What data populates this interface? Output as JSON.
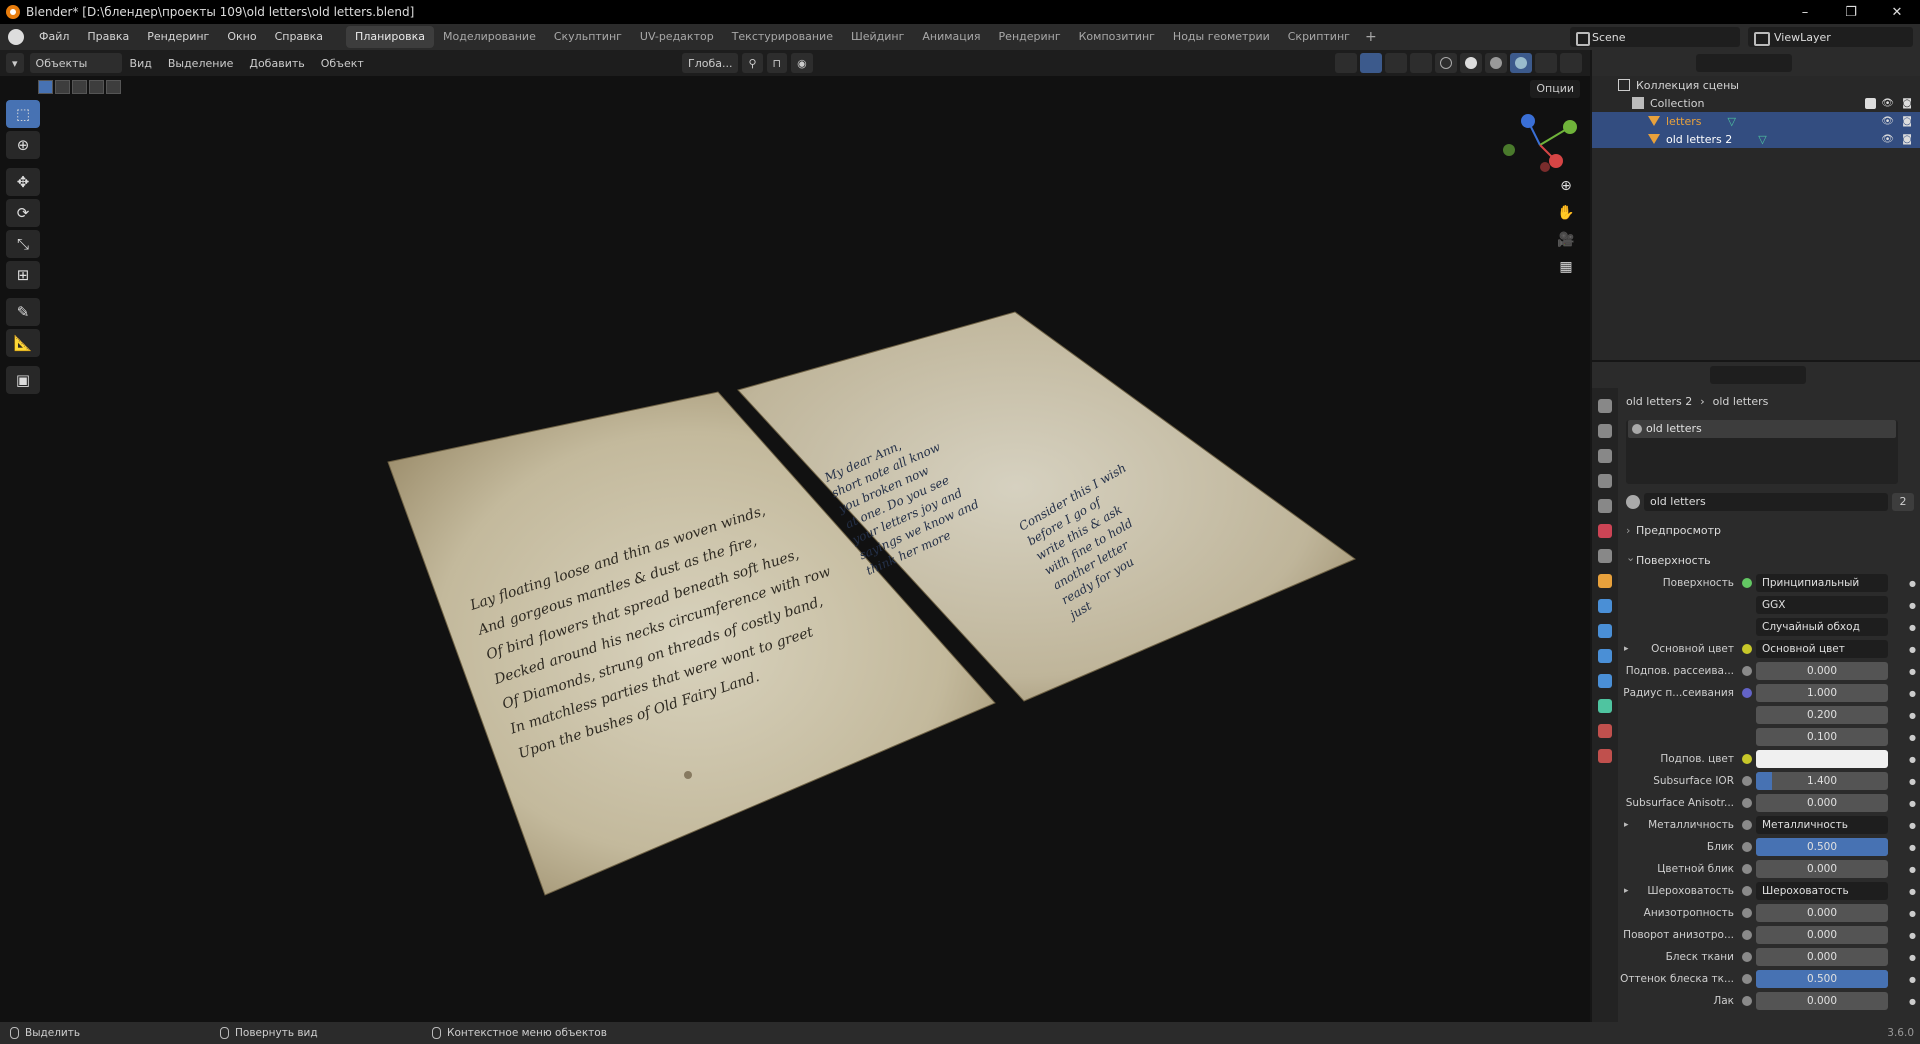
{
  "window": {
    "title": "Blender* [D:\\блендер\\проекты 109\\old letters\\old letters.blend]",
    "controls": {
      "minimize": "–",
      "maximize": "❐",
      "close": "✕"
    }
  },
  "menubar": {
    "menus": [
      "Файл",
      "Правка",
      "Рендеринг",
      "Окно",
      "Справка"
    ],
    "workspaces": [
      "Планировка",
      "Моделирование",
      "Скульптинг",
      "UV-редактор",
      "Текстурирование",
      "Шейдинг",
      "Анимация",
      "Рендеринг",
      "Композитинг",
      "Ноды геометрии",
      "Скриптинг"
    ],
    "active_workspace": "Планировка",
    "add_workspace": "+",
    "scene": "Scene",
    "view_layer": "ViewLayer"
  },
  "viewport_header": {
    "mode": "Объекты",
    "menus": [
      "Вид",
      "Выделение",
      "Добавить",
      "Объект"
    ],
    "orientation": "Глоба...",
    "options": "Опции"
  },
  "toolbar": {
    "icons": [
      "select-box-icon",
      "cursor-icon",
      "move-icon",
      "rotate-icon",
      "scale-icon",
      "transform-icon",
      "annotate-icon",
      "measure-icon",
      "add-cube-icon"
    ]
  },
  "scene_view": {
    "letter1_lines": [
      "Lay floating loose and thin as woven winds,",
      "And gorgeous mantles & dust as the fire,",
      "Of bird flowers that spread beneath soft hues,",
      "Decked around his necks circumference with row",
      "Of Diamonds, strung on threads of costly band,",
      "In matchless parties that were wont to greet",
      "Upon the bushes of Old Fairy Land."
    ],
    "letter2_lines_left": [
      "My dear Ann,",
      "short note all know",
      "you broken now",
      "at one. Do you see",
      "your letters joy and",
      "sayings we know and",
      "think her more"
    ],
    "letter2_lines_right": [
      "Consider this I wish",
      "before I go of",
      "write this & ask",
      "with fine to hold",
      "another letter",
      "ready for you",
      "just"
    ]
  },
  "outliner": {
    "root": "Коллекция сцены",
    "collection": "Collection",
    "items": [
      {
        "name": "letters",
        "selected": true,
        "color": "#e8a13c"
      },
      {
        "name": "old letters 2",
        "selected": true,
        "color": "#ffffff"
      }
    ]
  },
  "properties": {
    "breadcrumb": {
      "object": "old letters 2",
      "material": "old letters"
    },
    "slots": [
      "old letters"
    ],
    "material_name": "old letters",
    "material_users": "2",
    "panels": {
      "preview": "Предпросмотр",
      "surface": "Поверхность"
    },
    "rows": [
      {
        "label": "Поверхность",
        "type": "node",
        "value": "Принципиальный BSDF",
        "dot": "green"
      },
      {
        "label": "",
        "type": "dropdown",
        "value": "GGX"
      },
      {
        "label": "",
        "type": "dropdown",
        "value": "Случайный обход"
      },
      {
        "label": "Основной цвет",
        "type": "node",
        "value": "Основной цвет",
        "dot": "yellow",
        "expand": true
      },
      {
        "label": "Подпов. рассеива...",
        "type": "num",
        "value": "0.000",
        "dot": "grey",
        "fill": 0
      },
      {
        "label": "Радиус п...сеивания",
        "type": "num",
        "value": "1.000",
        "dot": "blue",
        "fill": 0
      },
      {
        "label": "",
        "type": "num",
        "value": "0.200",
        "fill": 0
      },
      {
        "label": "",
        "type": "num",
        "value": "0.100",
        "fill": 0
      },
      {
        "label": "Подпов. цвет",
        "type": "color",
        "value": "",
        "dot": "yellow"
      },
      {
        "label": "Subsurface IOR",
        "type": "num",
        "value": "1.400",
        "dot": "grey",
        "fill": 0.12
      },
      {
        "label": "Subsurface Anisotr...",
        "type": "num",
        "value": "0.000",
        "dot": "grey",
        "fill": 0
      },
      {
        "label": "Металличность",
        "type": "node",
        "value": "Металличность",
        "dot": "grey",
        "expand": true
      },
      {
        "label": "Блик",
        "type": "num",
        "value": "0.500",
        "dot": "grey",
        "fill": 1.0
      },
      {
        "label": "Цветной блик",
        "type": "num",
        "value": "0.000",
        "dot": "grey",
        "fill": 0
      },
      {
        "label": "Шероховатость",
        "type": "node",
        "value": "Шероховатость",
        "dot": "grey",
        "expand": true
      },
      {
        "label": "Анизотропность",
        "type": "num",
        "value": "0.000",
        "dot": "grey",
        "fill": 0
      },
      {
        "label": "Поворот анизотро...",
        "type": "num",
        "value": "0.000",
        "dot": "grey",
        "fill": 0
      },
      {
        "label": "Блеск ткани",
        "type": "num",
        "value": "0.000",
        "dot": "grey",
        "fill": 0
      },
      {
        "label": "Оттенок блеска тк...",
        "type": "num",
        "value": "0.500",
        "dot": "grey",
        "fill": 1.0
      },
      {
        "label": "Лак",
        "type": "num",
        "value": "0.000",
        "dot": "grey",
        "fill": 0
      }
    ]
  },
  "statusbar": {
    "select": "Выделить",
    "rotate_view": "Повернуть вид",
    "context_menu": "Контекстное меню объектов",
    "version": "3.6.0"
  },
  "colors": {
    "accent": "#4772b3",
    "selection": "#334d80",
    "paper": "#cfc7b0"
  }
}
